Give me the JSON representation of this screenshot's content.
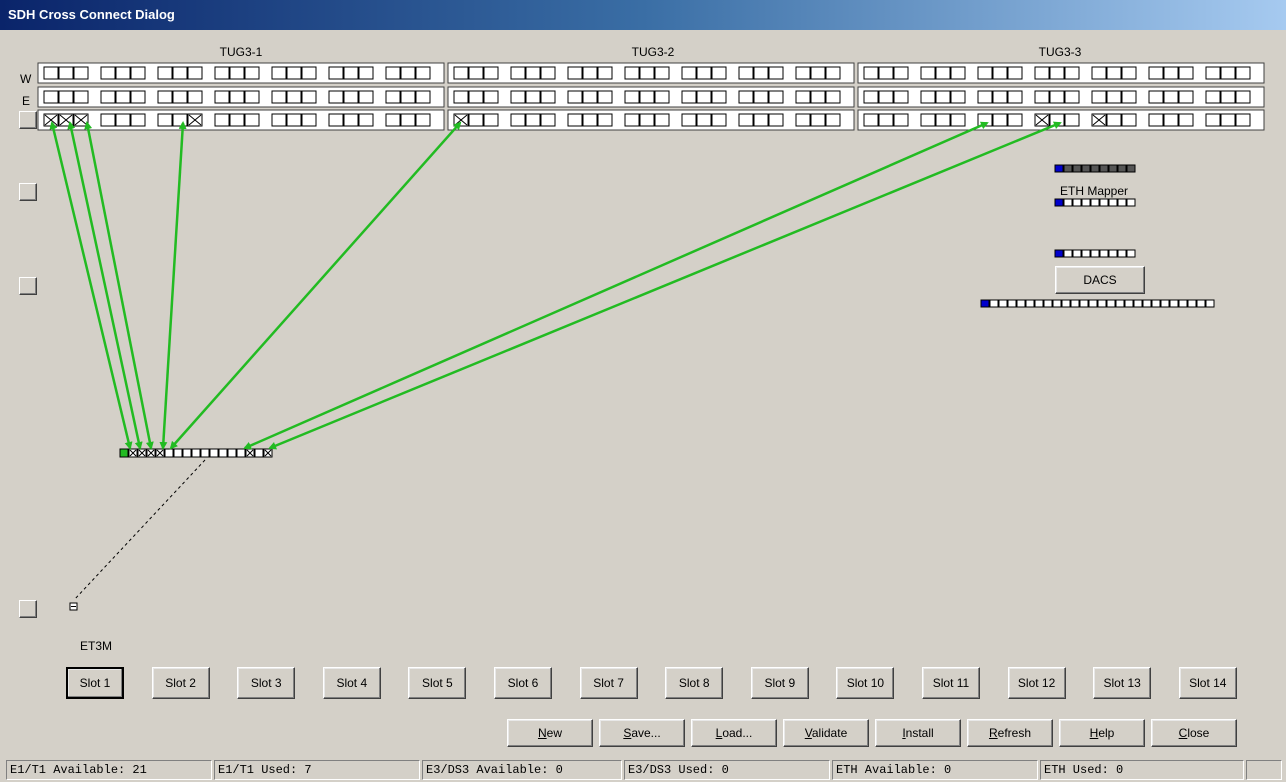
{
  "window": {
    "title": "SDH Cross Connect Dialog"
  },
  "tugs": [
    "TUG3-1",
    "TUG3-2",
    "TUG3-3"
  ],
  "row_labels": {
    "west": "W",
    "east": "E"
  },
  "eth_mapper": {
    "label": "ETH Mapper"
  },
  "dacs": {
    "label": "DACS"
  },
  "card": {
    "label": "ET3M"
  },
  "slots": [
    "Slot 1",
    "Slot 2",
    "Slot 3",
    "Slot 4",
    "Slot 5",
    "Slot 6",
    "Slot 7",
    "Slot 8",
    "Slot 9",
    "Slot 10",
    "Slot 11",
    "Slot 12",
    "Slot 13",
    "Slot 14"
  ],
  "selected_slot": "Slot 1",
  "actions": [
    {
      "label": "New",
      "key": "N"
    },
    {
      "label": "Save...",
      "key": "S"
    },
    {
      "label": "Load...",
      "key": "L"
    },
    {
      "label": "Validate",
      "key": "V"
    },
    {
      "label": "Install",
      "key": "I"
    },
    {
      "label": "Refresh",
      "key": "R"
    },
    {
      "label": "Help",
      "key": "H"
    },
    {
      "label": "Close",
      "key": "C"
    }
  ],
  "status": {
    "e1_available": "E1/T1 Available: 21",
    "e1_used": "E1/T1 Used: 7",
    "e3_available": "E3/DS3 Available: 0",
    "e3_used": "E3/DS3 Used: 0",
    "eth_available": "ETH Available: 0",
    "eth_used": "ETH Used: 0"
  },
  "colors": {
    "connection": "#22bb22",
    "port_active": "#0000cc",
    "port_used_green": "#22bb22"
  }
}
